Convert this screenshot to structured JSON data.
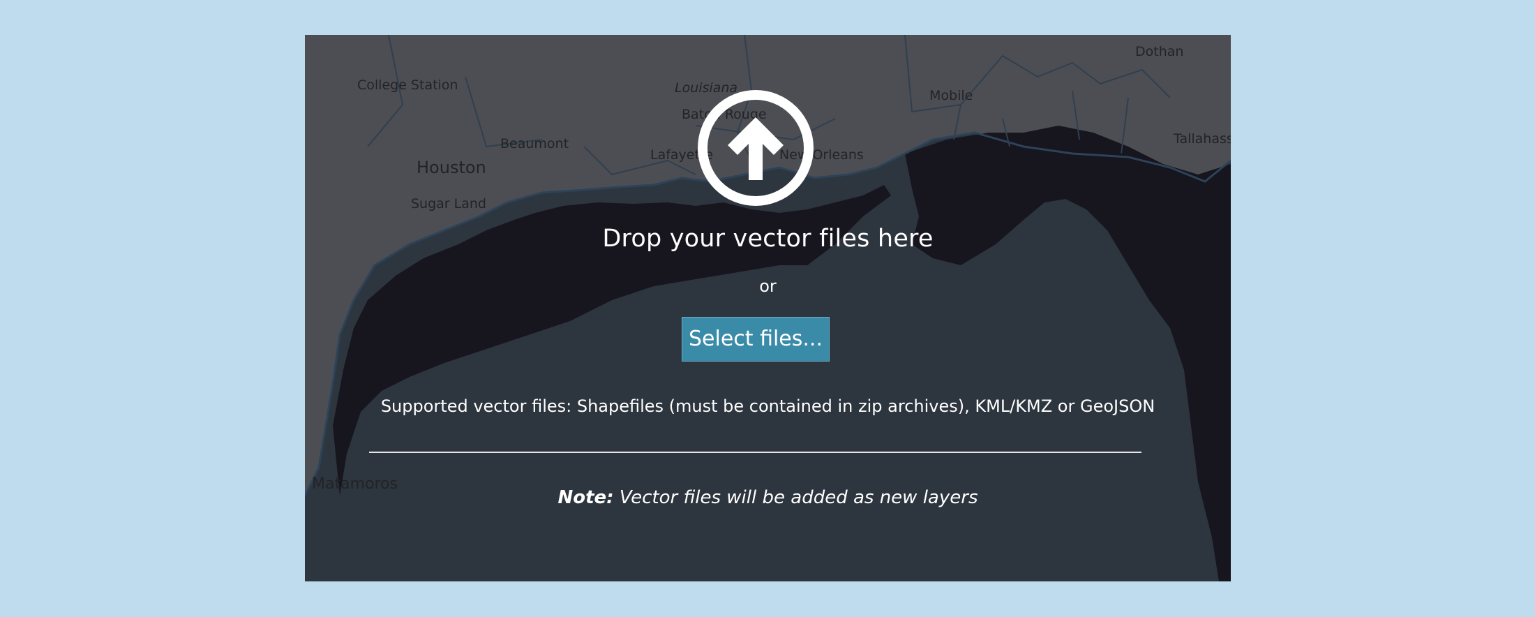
{
  "dropzone": {
    "icon": "upload-arrow-circle-icon",
    "title": "Drop your vector files here",
    "or_text": "or",
    "select_button_label": "Select files...",
    "supported_text": "Supported vector files: Shapefiles (must be contained in zip archives), KML/KMZ or GeoJSON",
    "note_label": "Note:",
    "note_text": " Vector files will be added as new layers"
  },
  "map": {
    "labels": {
      "college_station": "College Station",
      "louisiana": "Louisiana",
      "baton_rouge": "Baton Rouge",
      "beaumont": "Beaumont",
      "houston": "Houston",
      "sugar_land": "Sugar Land",
      "lafayette": "Lafayette",
      "new_orleans": "New Orleans",
      "mobile": "Mobile",
      "dothan": "Dothan",
      "tallahassee": "Tallahassee",
      "matamoros": "Matamoros"
    }
  },
  "colors": {
    "page_background": "#bfdcee",
    "button": "#3a8ba8",
    "ocean": "#3b4650",
    "data_dark": "#1a1420"
  }
}
